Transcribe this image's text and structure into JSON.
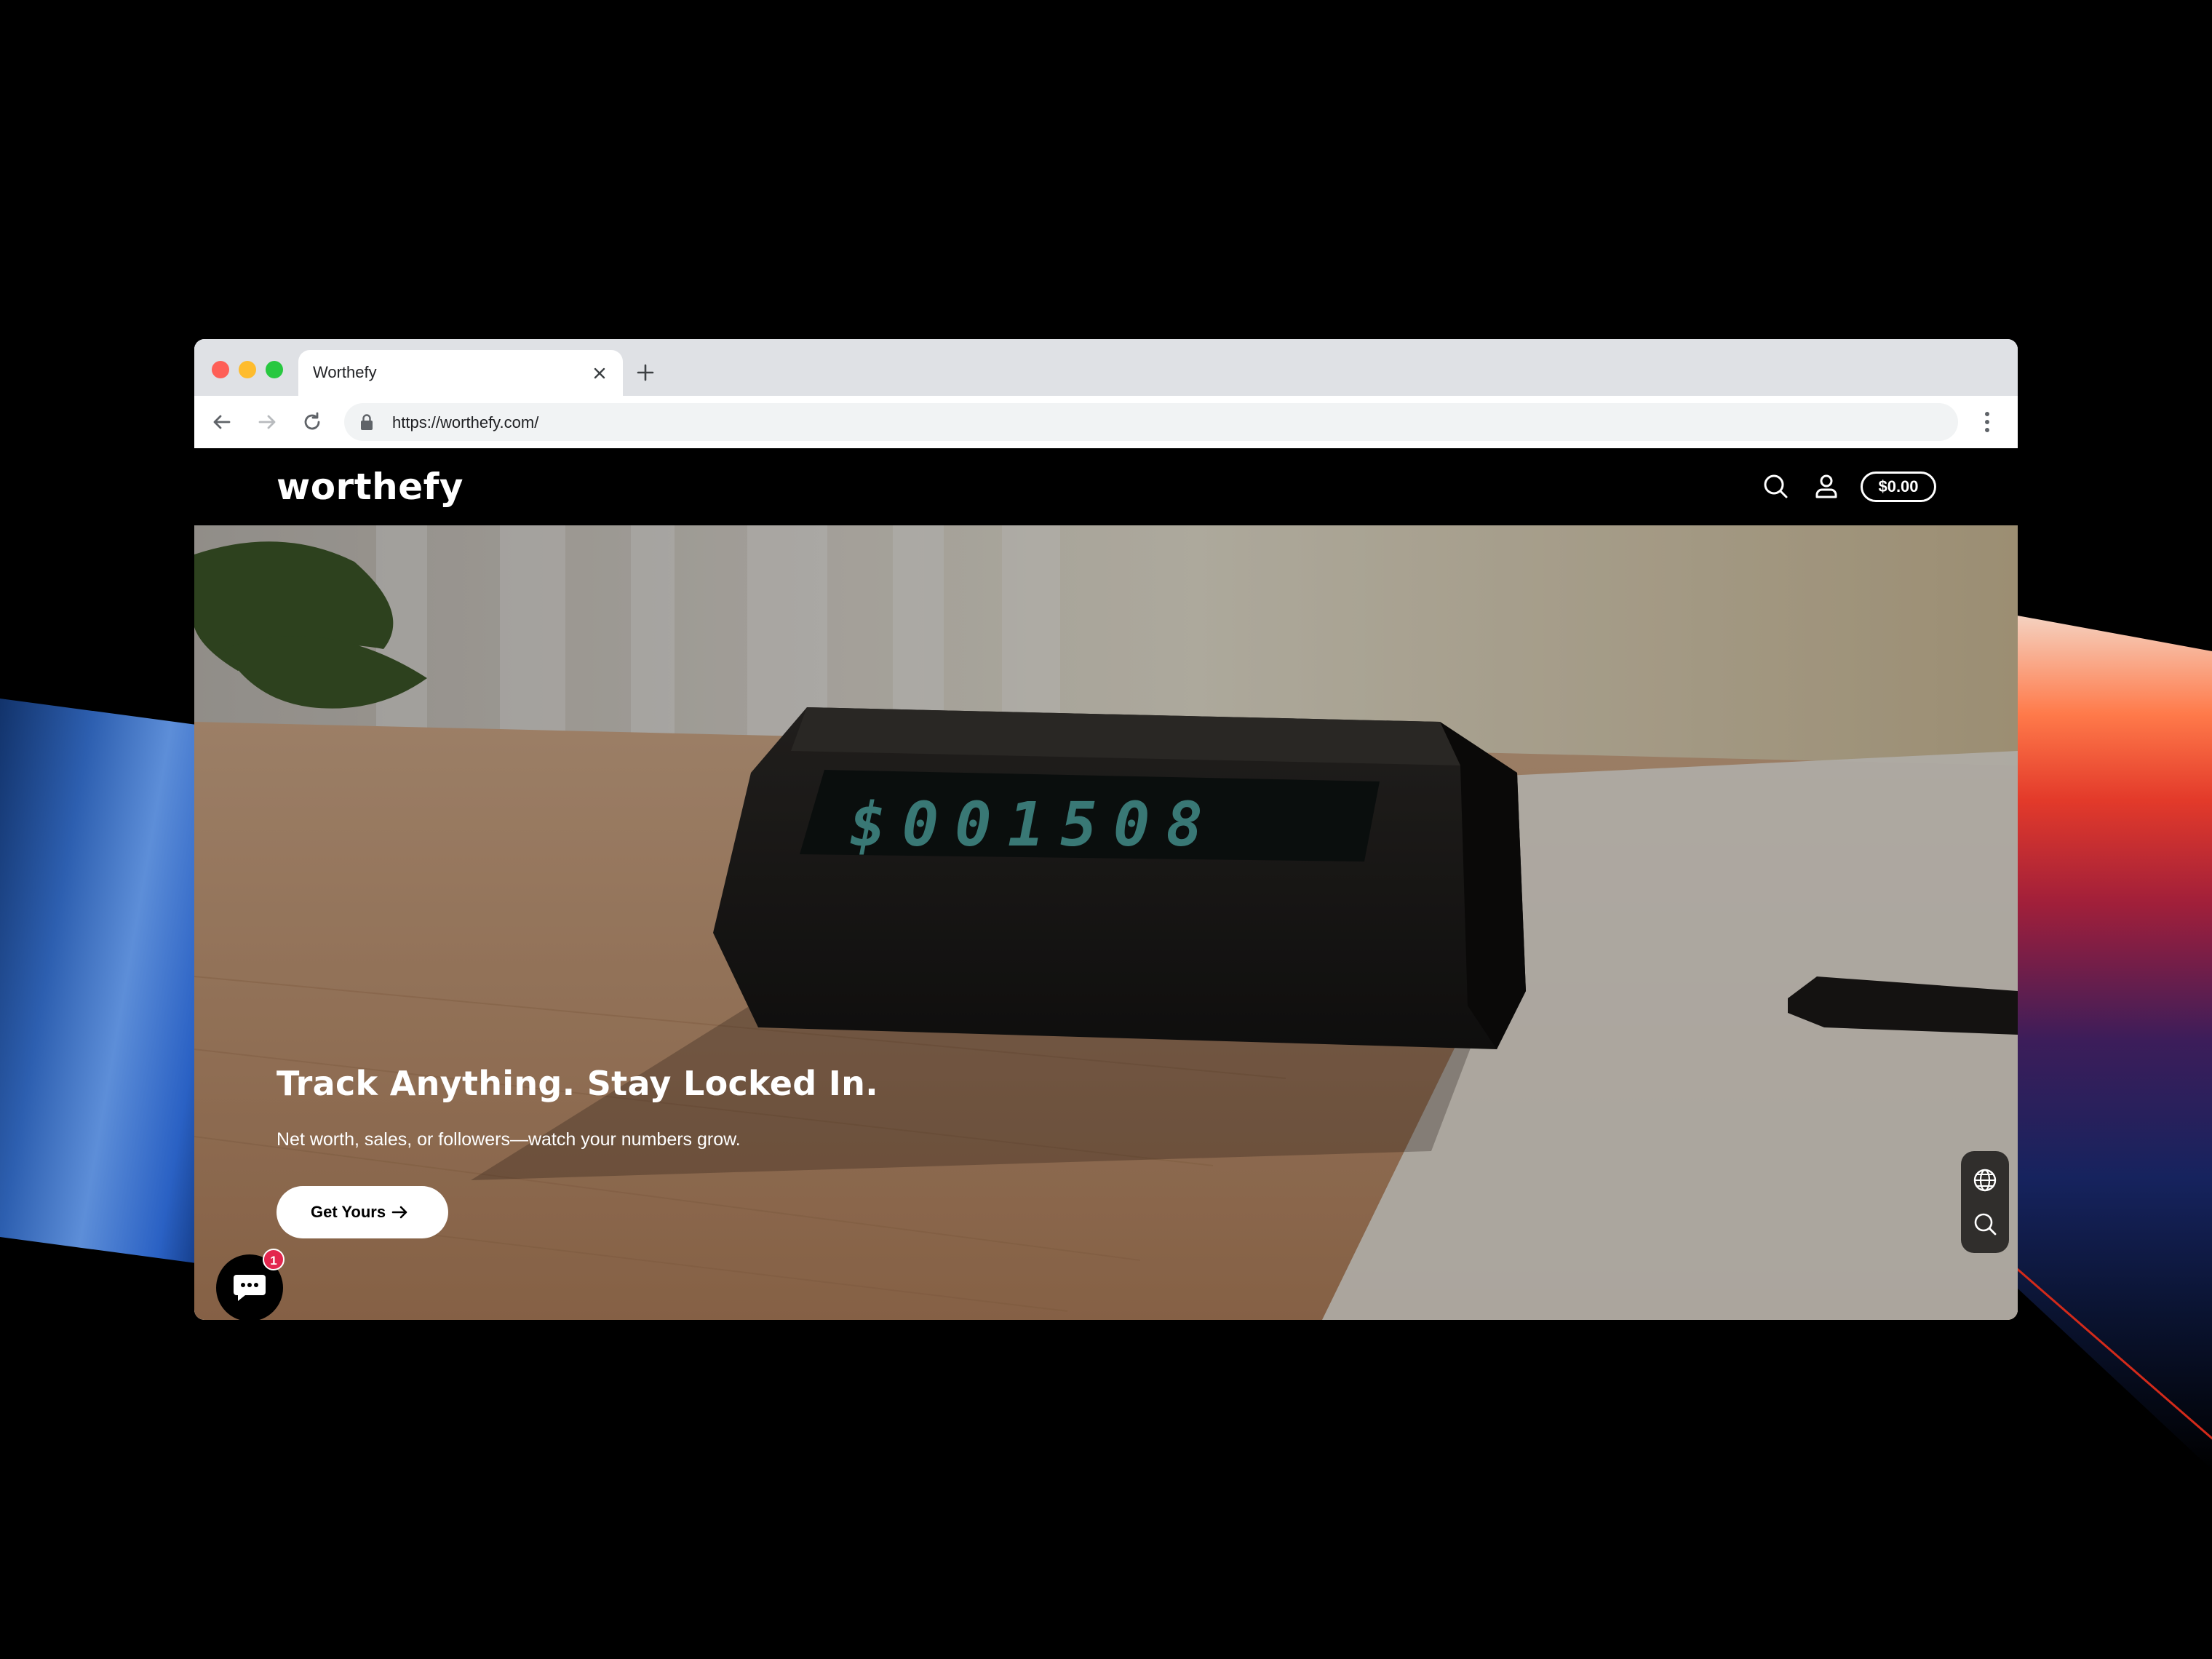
{
  "browser": {
    "tab_title": "Worthefy",
    "url": "https://worthefy.com/"
  },
  "site": {
    "logo": "worthefy",
    "cart_total": "$0.00",
    "icons": [
      "search-icon",
      "account-icon"
    ]
  },
  "hero": {
    "device_display": "$001508",
    "title": "Track Anything. Stay Locked In.",
    "subtitle": "Net worth, sales, or followers—watch your numbers grow.",
    "cta_label": "Get Yours"
  },
  "widgets": {
    "side_tools": [
      "globe-icon",
      "search-icon"
    ],
    "chat_badge": "1"
  },
  "colors": {
    "header_bg": "#000000",
    "display_digits": "#4fa7a3",
    "badge": "#e3264e"
  }
}
